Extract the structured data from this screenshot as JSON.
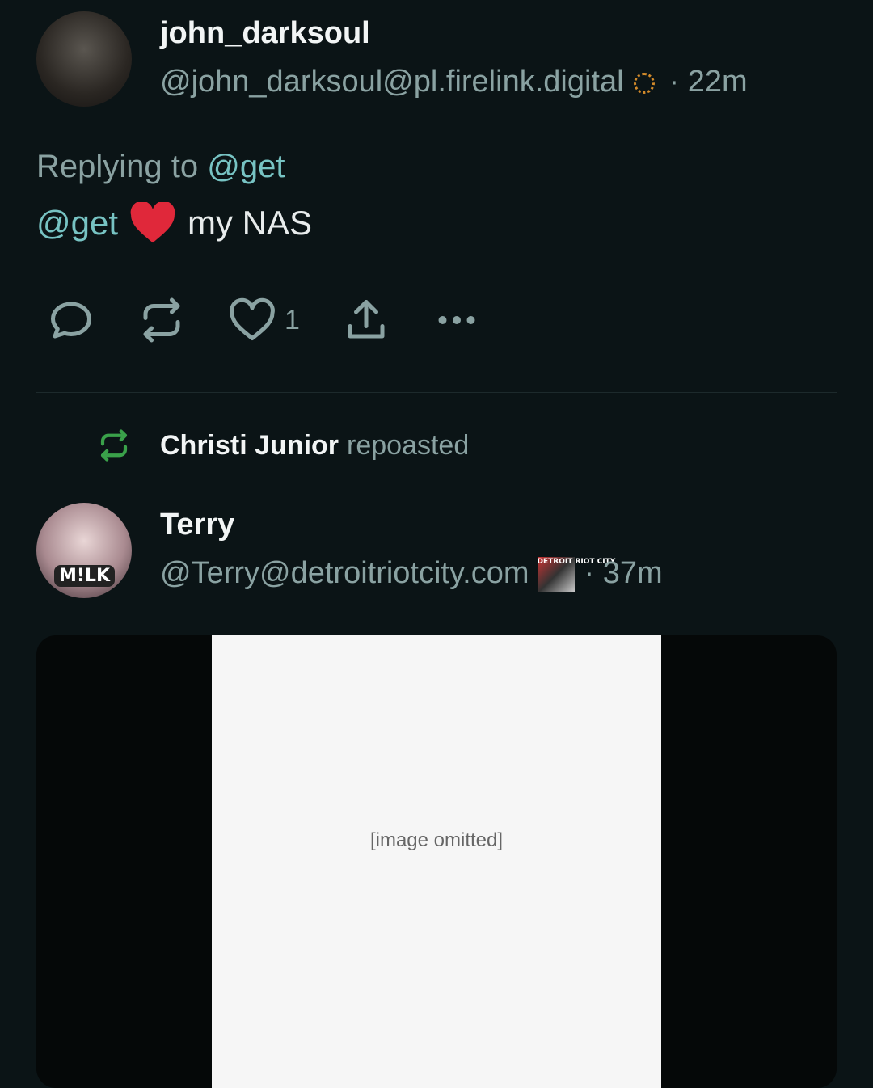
{
  "post1": {
    "display_name": "john_darksoul",
    "handle": "@john_darksoul@pl.firelink.digital",
    "time": "· 22m",
    "replying_prefix": "Replying to",
    "replying_to": "@get",
    "mention": "@get",
    "text": "my NAS",
    "like_count": "1"
  },
  "repost": {
    "reposter": "Christi Junior",
    "label": "repoasted"
  },
  "post2": {
    "display_name": "Terry",
    "handle": "@Terry@detroitriotcity.com",
    "time": "· 37m",
    "avatar_label": "M!LK",
    "instance_badge": "DETROIT RIOT CITY",
    "media_note": "[image omitted]"
  },
  "colors": {
    "background": "#0b1416",
    "accent": "#77c3c3",
    "muted": "#8aa2a2",
    "repost_green": "#3aa14a"
  },
  "icons": [
    "reply-icon",
    "repost-icon",
    "like-icon",
    "share-icon",
    "more-icon"
  ]
}
